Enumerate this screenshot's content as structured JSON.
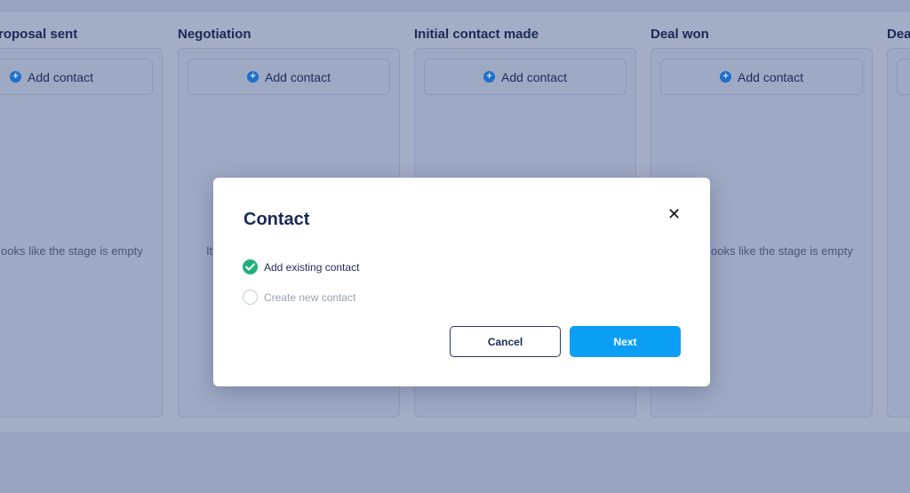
{
  "board": {
    "add_label": "Add contact",
    "empty_message": "It looks like the stage is empty",
    "columns": [
      {
        "title": "Proposal sent",
        "empty_text": "ooks like the stage is empty"
      },
      {
        "title": "Negotiation",
        "empty_text": "It"
      },
      {
        "title": "Initial contact made",
        "empty_text": ""
      },
      {
        "title": "Deal won",
        "empty_text": "ooks like the stage is empty"
      },
      {
        "title": "Deal lost",
        "empty_text": ""
      }
    ]
  },
  "modal": {
    "title": "Contact",
    "close_icon": "close-icon",
    "options": [
      {
        "label": "Add existing contact",
        "selected": true
      },
      {
        "label": "Create new contact",
        "selected": false
      }
    ],
    "cancel_label": "Cancel",
    "next_label": "Next"
  },
  "colors": {
    "overlay": "#9aa4bf",
    "accent": "#0a9ff5",
    "check": "#21b07a",
    "title": "#1b2a57"
  }
}
